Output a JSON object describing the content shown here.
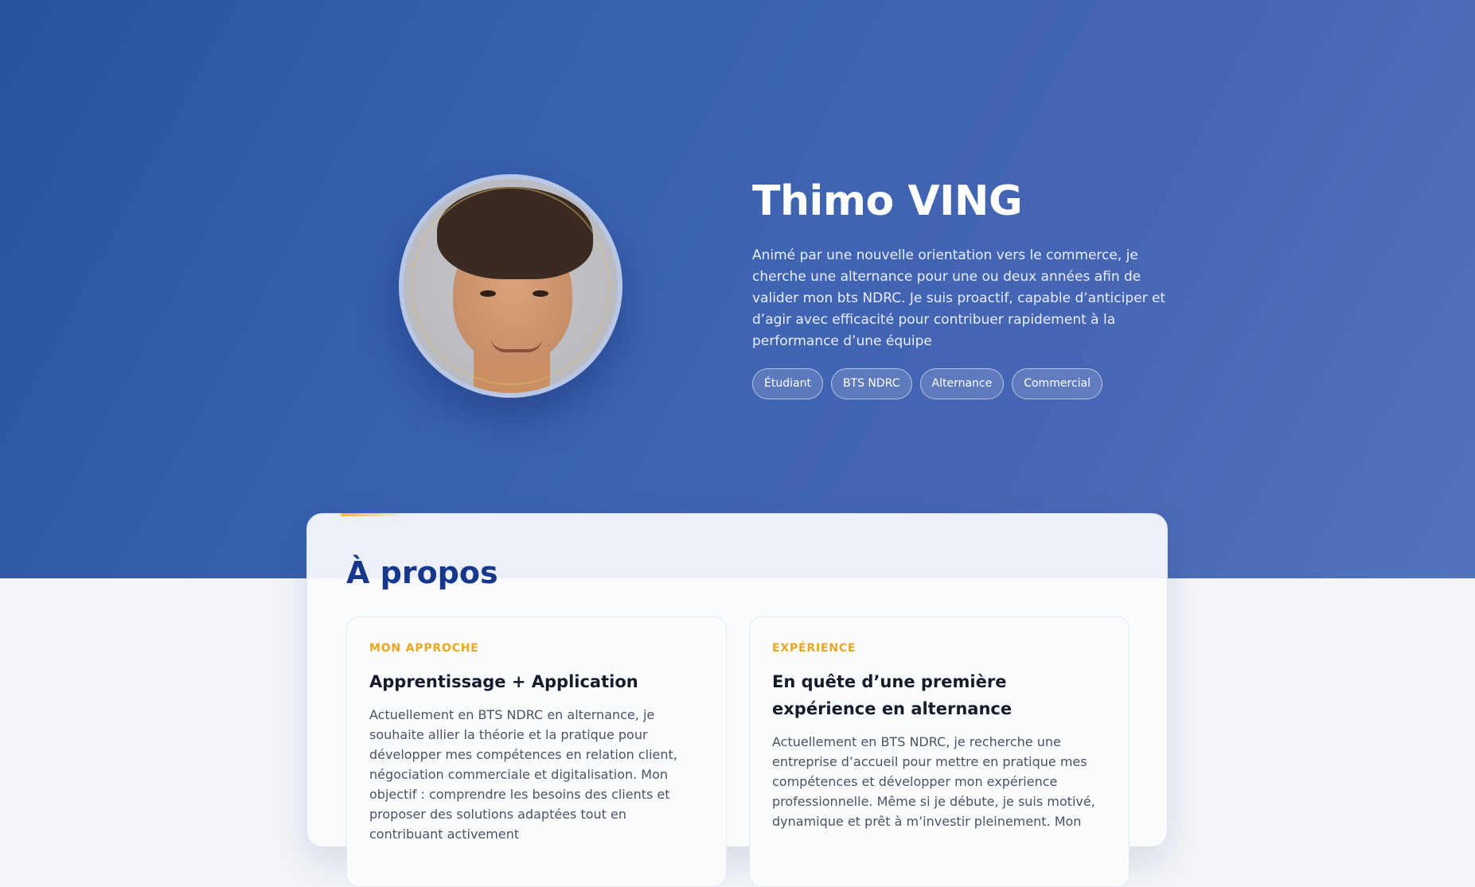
{
  "hero": {
    "name": "Thimo VING",
    "description": "Animé par une nouvelle orientation vers le commerce, je cherche une alternance pour une ou deux années afin de valider mon bts NDRC. Je suis proactif, capable d’anticiper et d’agir avec efficacité pour contribuer rapidement à la performance d’une équipe",
    "tags": [
      "Étudiant",
      "BTS NDRC",
      "Alternance",
      "Commercial"
    ],
    "avatar_icon": "profile-photo",
    "colors": {
      "gradient_start": "#2a52a0",
      "gradient_end": "#5473bd"
    }
  },
  "about": {
    "title": "À propos",
    "cards": [
      {
        "eyebrow": "MON APPROCHE",
        "heading": "Apprentissage + Application",
        "text": "Actuellement en BTS NDRC en alternance, je souhaite allier la théorie et la pratique pour développer mes compétences en relation client, négociation commerciale et digitalisation. Mon objectif : comprendre les besoins des clients et proposer des solutions adaptées tout en contribuant activement"
      },
      {
        "eyebrow": "EXPÉRIENCE",
        "heading": "En quête d’une première expérience en alternance",
        "text": "Actuellement en BTS NDRC, je recherche une entreprise d’accueil pour mettre en pratique mes compétences et développer mon expérience professionnelle. Même si je débute, je suis motivé, dynamique et prêt à m’investir pleinement. Mon"
      }
    ],
    "colors": {
      "title": "#17388a",
      "eyebrow": "#e9a722"
    }
  }
}
